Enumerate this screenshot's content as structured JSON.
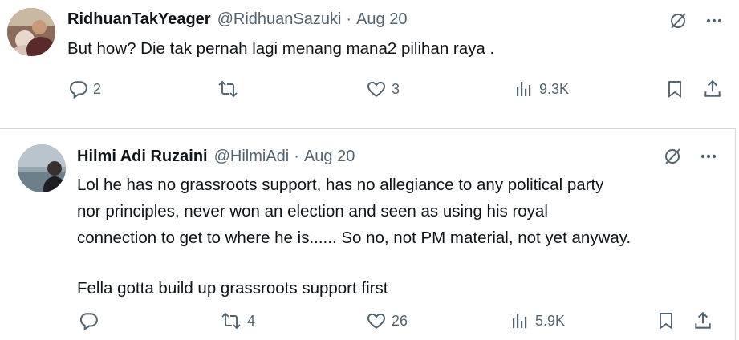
{
  "tweets": [
    {
      "author": {
        "name": "RidhuanTakYeager",
        "handle": "@RidhuanSazuki",
        "avatar_icon": "user-avatar"
      },
      "separator": "·",
      "date": "Aug 20",
      "text_lines": [
        "But how? Die tak pernah lagi menang mana2 pilihan raya ."
      ],
      "stats": {
        "replies": "2",
        "reposts": "",
        "likes": "3",
        "views": "9.3K"
      }
    },
    {
      "author": {
        "name": "Hilmi Adi Ruzaini",
        "handle": "@HilmiAdi",
        "avatar_icon": "user-avatar"
      },
      "separator": "·",
      "date": "Aug 20",
      "text_lines": [
        "Lol he has no grassroots support, has no allegiance to any political party",
        "nor principles, never won an election and seen as using his royal",
        "connection to get to where he is...... So no, not PM material, not yet anyway.",
        "Fella gotta build up grassroots support first"
      ],
      "stats": {
        "replies": "",
        "reposts": "4",
        "likes": "26",
        "views": "5.9K"
      }
    }
  ],
  "colors": {
    "text": "#0f1419",
    "secondary": "#536471",
    "divider": "#cfd9de"
  },
  "icons": [
    "grok-icon",
    "more-icon",
    "reply-icon",
    "repost-icon",
    "like-icon",
    "views-icon",
    "bookmark-icon",
    "share-icon"
  ]
}
